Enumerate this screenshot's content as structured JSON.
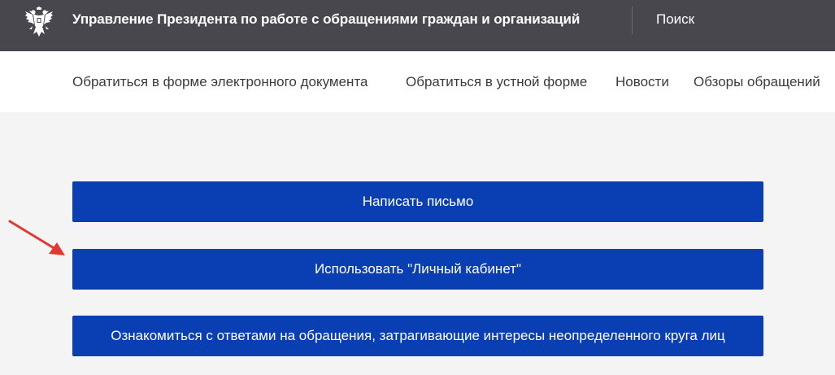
{
  "header": {
    "title": "Управление Президента по работе с обращениями граждан и организаций",
    "search_label": "Поиск",
    "emblem_icon": "russian-eagle-emblem-icon",
    "background_color": "#48474d"
  },
  "nav": {
    "items": [
      {
        "label": "Обратиться в форме электронного документа"
      },
      {
        "label": "Обратиться в устной форме"
      },
      {
        "label": "Новости"
      },
      {
        "label": "Обзоры обращений"
      }
    ]
  },
  "actions": [
    {
      "label": "Написать письмо"
    },
    {
      "label": "Использовать \"Личный кабинет\""
    },
    {
      "label": "Ознакомиться с ответами на обращения, затрагивающие интересы неопределенного круга лиц"
    }
  ],
  "annotation": {
    "icon": "red-arrow-icon",
    "color": "#e03a30"
  },
  "colors": {
    "button": "#0a3fb4",
    "page_background": "#f4f4f4"
  }
}
